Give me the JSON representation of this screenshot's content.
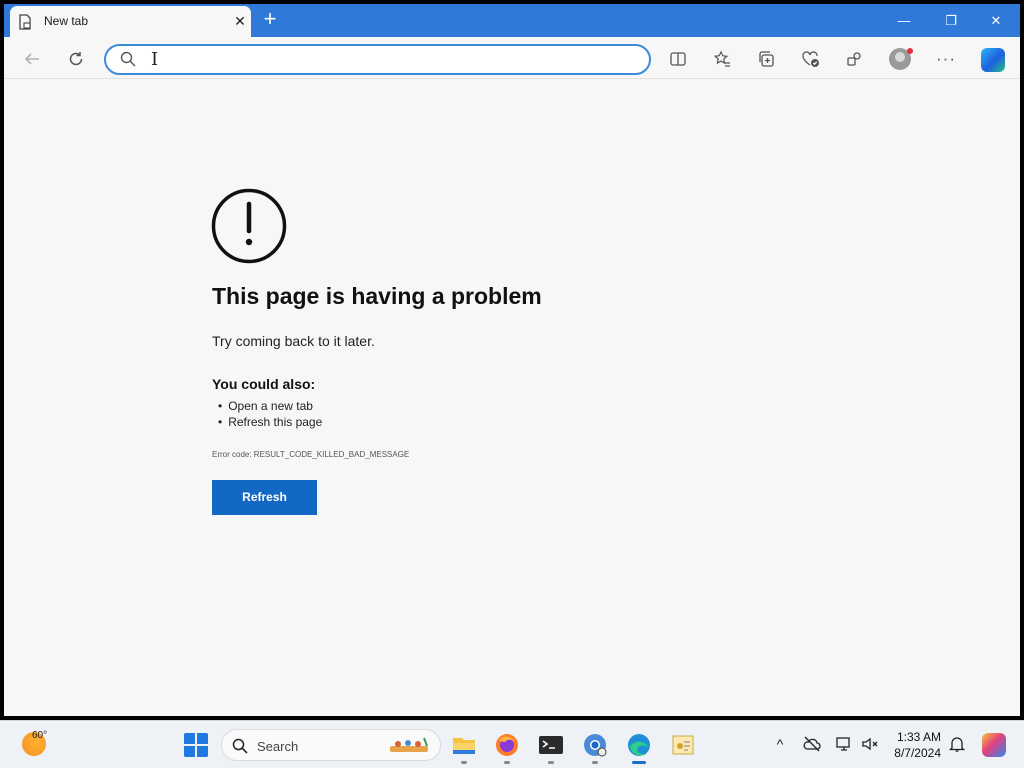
{
  "browser": {
    "tab_title": "New tab",
    "close_symbol": "✕",
    "new_tab_symbol": "+",
    "window_controls": {
      "minimize": "—",
      "restore": "❐",
      "close": "✕"
    },
    "address_bar": {
      "value": "",
      "placeholder": ""
    },
    "toolbar_icons": [
      "back-icon",
      "refresh-icon",
      "split-screen-icon",
      "favorites-icon",
      "collections-icon",
      "browser-essentials-icon",
      "extensions-icon",
      "profile-avatar",
      "more-options-icon",
      "copilot-icon"
    ],
    "more_symbol": "···"
  },
  "error_page": {
    "title": "This page is having a problem",
    "subtitle": "Try coming back to it later.",
    "also_heading": "You could also:",
    "suggestions": [
      "Open a new tab",
      "Refresh this page"
    ],
    "error_code": "Error code: RESULT_CODE_KILLED_BAD_MESSAGE",
    "refresh_label": "Refresh",
    "accent_color": "#1368c4"
  },
  "taskbar": {
    "weather_temp": "60°",
    "search_label": "Search",
    "apps": [
      "start-icon",
      "file-explorer-icon",
      "firefox-icon",
      "terminal-icon",
      "chrome-icon",
      "edge-icon",
      "certificate-app-icon"
    ],
    "tray": {
      "chevron": "^",
      "time": "1:33 AM",
      "date": "8/7/2024"
    }
  }
}
